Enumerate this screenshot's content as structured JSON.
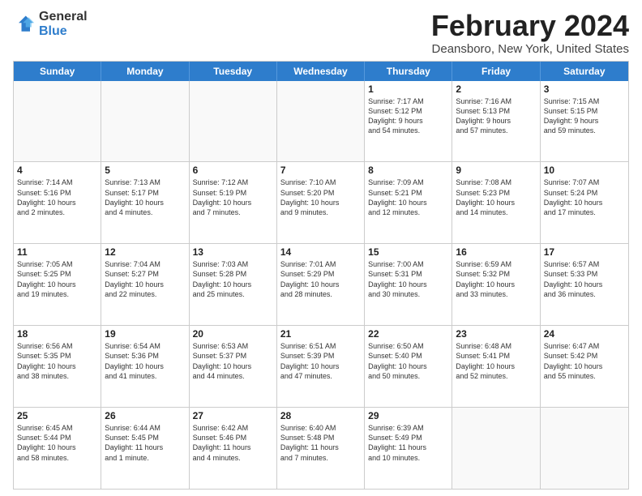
{
  "logo": {
    "general": "General",
    "blue": "Blue"
  },
  "title": "February 2024",
  "subtitle": "Deansboro, New York, United States",
  "days_of_week": [
    "Sunday",
    "Monday",
    "Tuesday",
    "Wednesday",
    "Thursday",
    "Friday",
    "Saturday"
  ],
  "weeks": [
    [
      {
        "day": "",
        "info": ""
      },
      {
        "day": "",
        "info": ""
      },
      {
        "day": "",
        "info": ""
      },
      {
        "day": "",
        "info": ""
      },
      {
        "day": "1",
        "info": "Sunrise: 7:17 AM\nSunset: 5:12 PM\nDaylight: 9 hours\nand 54 minutes."
      },
      {
        "day": "2",
        "info": "Sunrise: 7:16 AM\nSunset: 5:13 PM\nDaylight: 9 hours\nand 57 minutes."
      },
      {
        "day": "3",
        "info": "Sunrise: 7:15 AM\nSunset: 5:15 PM\nDaylight: 9 hours\nand 59 minutes."
      }
    ],
    [
      {
        "day": "4",
        "info": "Sunrise: 7:14 AM\nSunset: 5:16 PM\nDaylight: 10 hours\nand 2 minutes."
      },
      {
        "day": "5",
        "info": "Sunrise: 7:13 AM\nSunset: 5:17 PM\nDaylight: 10 hours\nand 4 minutes."
      },
      {
        "day": "6",
        "info": "Sunrise: 7:12 AM\nSunset: 5:19 PM\nDaylight: 10 hours\nand 7 minutes."
      },
      {
        "day": "7",
        "info": "Sunrise: 7:10 AM\nSunset: 5:20 PM\nDaylight: 10 hours\nand 9 minutes."
      },
      {
        "day": "8",
        "info": "Sunrise: 7:09 AM\nSunset: 5:21 PM\nDaylight: 10 hours\nand 12 minutes."
      },
      {
        "day": "9",
        "info": "Sunrise: 7:08 AM\nSunset: 5:23 PM\nDaylight: 10 hours\nand 14 minutes."
      },
      {
        "day": "10",
        "info": "Sunrise: 7:07 AM\nSunset: 5:24 PM\nDaylight: 10 hours\nand 17 minutes."
      }
    ],
    [
      {
        "day": "11",
        "info": "Sunrise: 7:05 AM\nSunset: 5:25 PM\nDaylight: 10 hours\nand 19 minutes."
      },
      {
        "day": "12",
        "info": "Sunrise: 7:04 AM\nSunset: 5:27 PM\nDaylight: 10 hours\nand 22 minutes."
      },
      {
        "day": "13",
        "info": "Sunrise: 7:03 AM\nSunset: 5:28 PM\nDaylight: 10 hours\nand 25 minutes."
      },
      {
        "day": "14",
        "info": "Sunrise: 7:01 AM\nSunset: 5:29 PM\nDaylight: 10 hours\nand 28 minutes."
      },
      {
        "day": "15",
        "info": "Sunrise: 7:00 AM\nSunset: 5:31 PM\nDaylight: 10 hours\nand 30 minutes."
      },
      {
        "day": "16",
        "info": "Sunrise: 6:59 AM\nSunset: 5:32 PM\nDaylight: 10 hours\nand 33 minutes."
      },
      {
        "day": "17",
        "info": "Sunrise: 6:57 AM\nSunset: 5:33 PM\nDaylight: 10 hours\nand 36 minutes."
      }
    ],
    [
      {
        "day": "18",
        "info": "Sunrise: 6:56 AM\nSunset: 5:35 PM\nDaylight: 10 hours\nand 38 minutes."
      },
      {
        "day": "19",
        "info": "Sunrise: 6:54 AM\nSunset: 5:36 PM\nDaylight: 10 hours\nand 41 minutes."
      },
      {
        "day": "20",
        "info": "Sunrise: 6:53 AM\nSunset: 5:37 PM\nDaylight: 10 hours\nand 44 minutes."
      },
      {
        "day": "21",
        "info": "Sunrise: 6:51 AM\nSunset: 5:39 PM\nDaylight: 10 hours\nand 47 minutes."
      },
      {
        "day": "22",
        "info": "Sunrise: 6:50 AM\nSunset: 5:40 PM\nDaylight: 10 hours\nand 50 minutes."
      },
      {
        "day": "23",
        "info": "Sunrise: 6:48 AM\nSunset: 5:41 PM\nDaylight: 10 hours\nand 52 minutes."
      },
      {
        "day": "24",
        "info": "Sunrise: 6:47 AM\nSunset: 5:42 PM\nDaylight: 10 hours\nand 55 minutes."
      }
    ],
    [
      {
        "day": "25",
        "info": "Sunrise: 6:45 AM\nSunset: 5:44 PM\nDaylight: 10 hours\nand 58 minutes."
      },
      {
        "day": "26",
        "info": "Sunrise: 6:44 AM\nSunset: 5:45 PM\nDaylight: 11 hours\nand 1 minute."
      },
      {
        "day": "27",
        "info": "Sunrise: 6:42 AM\nSunset: 5:46 PM\nDaylight: 11 hours\nand 4 minutes."
      },
      {
        "day": "28",
        "info": "Sunrise: 6:40 AM\nSunset: 5:48 PM\nDaylight: 11 hours\nand 7 minutes."
      },
      {
        "day": "29",
        "info": "Sunrise: 6:39 AM\nSunset: 5:49 PM\nDaylight: 11 hours\nand 10 minutes."
      },
      {
        "day": "",
        "info": ""
      },
      {
        "day": "",
        "info": ""
      }
    ]
  ]
}
